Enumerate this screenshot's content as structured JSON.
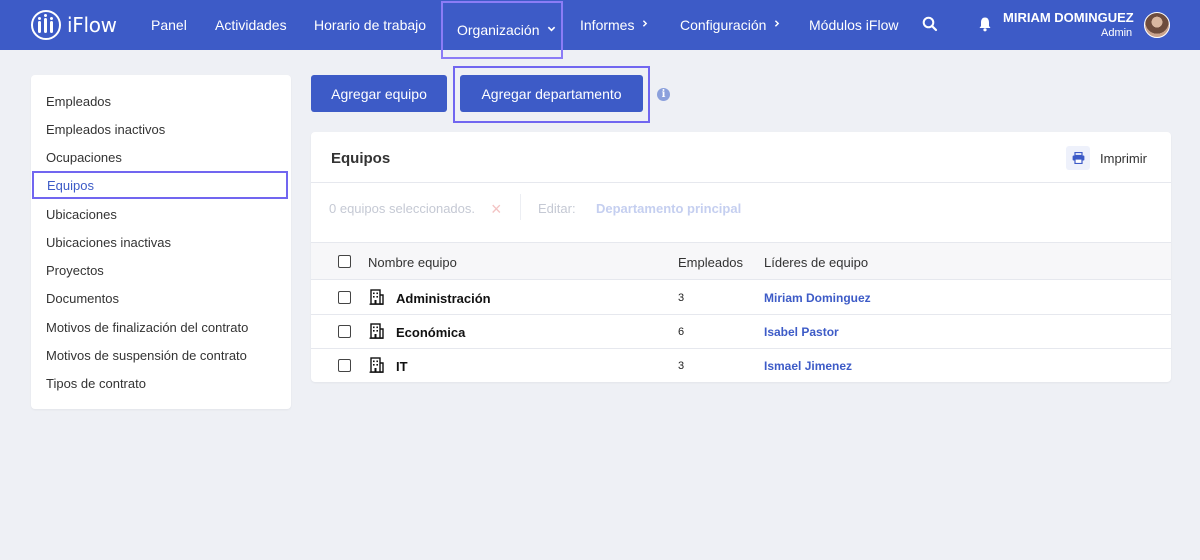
{
  "brand": {
    "name": "iFlow",
    "accent": "#3d5bc7",
    "highlight": "#7166f0"
  },
  "nav": {
    "items": [
      {
        "label": "Panel"
      },
      {
        "label": "Actividades"
      },
      {
        "label": "Horario de trabajo"
      },
      {
        "label": "Organización",
        "chevron": "chevron-down-icon"
      },
      {
        "label": "Informes",
        "chevron": "chevron-right-icon"
      },
      {
        "label": "Configuración",
        "chevron": "chevron-right-icon"
      },
      {
        "label": "Módulos iFlow"
      }
    ],
    "search_icon": "search-icon",
    "notification_icon": "bell-icon"
  },
  "user": {
    "name": "MIRIAM DOMINGUEZ",
    "role": "Admin"
  },
  "sidebar": {
    "items": [
      {
        "label": "Empleados"
      },
      {
        "label": "Empleados inactivos"
      },
      {
        "label": "Ocupaciones"
      },
      {
        "label": "Equipos",
        "active": true
      },
      {
        "label": "Ubicaciones"
      },
      {
        "label": "Ubicaciones inactivas"
      },
      {
        "label": "Proyectos"
      },
      {
        "label": "Documentos"
      },
      {
        "label": "Motivos de finalización del contrato"
      },
      {
        "label": "Motivos de suspensión de contrato"
      },
      {
        "label": "Tipos de contrato"
      }
    ]
  },
  "actions": {
    "add_team": "Agregar equipo",
    "add_department": "Agregar departamento",
    "info_icon": "info-icon"
  },
  "panel": {
    "title": "Equipos",
    "print_label": "Imprimir",
    "selection_text": "0 equipos seleccionados.",
    "clear_icon": "close-icon",
    "edit_label": "Editar:",
    "edit_link": "Departamento principal",
    "columns": {
      "name": "Nombre equipo",
      "employees": "Empleados",
      "leaders": "Líderes de equipo"
    },
    "rows": [
      {
        "name": "Administración",
        "employees": "3",
        "leader": "Miriam Dominguez"
      },
      {
        "name": "Económica",
        "employees": "6",
        "leader": "Isabel Pastor"
      },
      {
        "name": "IT",
        "employees": "3",
        "leader": "Ismael Jimenez"
      }
    ]
  }
}
